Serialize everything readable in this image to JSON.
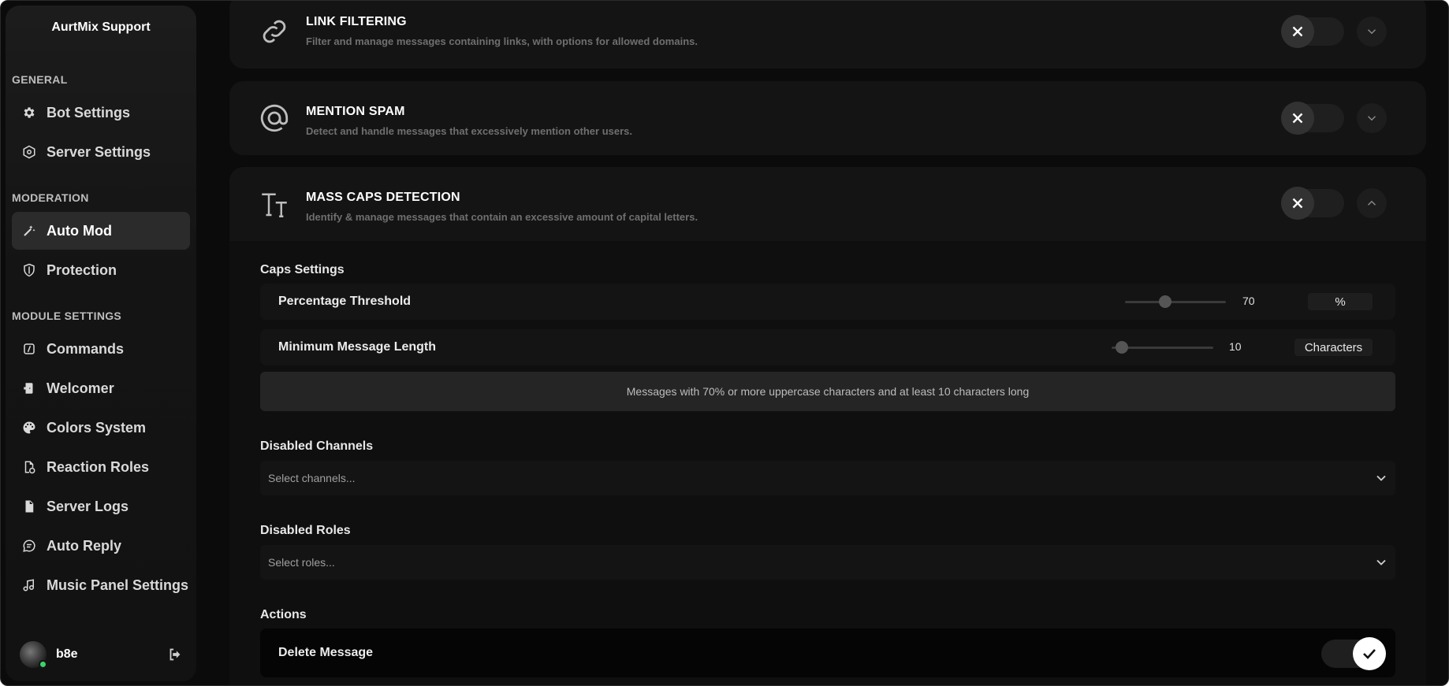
{
  "sidebar": {
    "brand": "AurtMix Support",
    "sections": [
      {
        "title": "GENERAL",
        "items": [
          {
            "label": "Bot Settings",
            "icon": "gear-icon"
          },
          {
            "label": "Server Settings",
            "icon": "hexagon-icon"
          }
        ]
      },
      {
        "title": "MODERATION",
        "items": [
          {
            "label": "Auto Mod",
            "icon": "magic-wand-icon",
            "active": true
          },
          {
            "label": "Protection",
            "icon": "shield-icon"
          }
        ]
      },
      {
        "title": "MODULE SETTINGS",
        "items": [
          {
            "label": "Commands",
            "icon": "slash-command-icon"
          },
          {
            "label": "Welcomer",
            "icon": "door-icon"
          },
          {
            "label": "Colors System",
            "icon": "palette-icon"
          },
          {
            "label": "Reaction Roles",
            "icon": "roles-icon"
          },
          {
            "label": "Server Logs",
            "icon": "file-icon"
          },
          {
            "label": "Auto Reply",
            "icon": "chat-icon"
          },
          {
            "label": "Music Panel Settings",
            "icon": "music-icon"
          }
        ]
      }
    ],
    "user": {
      "name": "b8e",
      "status": "online",
      "status_color": "#3bd26b"
    }
  },
  "modules": [
    {
      "title": "LINK FILTERING",
      "description": "Filter and manage messages containing links, with options for allowed domains.",
      "icon": "link-icon",
      "enabled": false,
      "expanded": false
    },
    {
      "title": "MENTION SPAM",
      "description": "Detect and handle messages that excessively mention other users.",
      "icon": "at-icon",
      "enabled": false,
      "expanded": false
    },
    {
      "title": "MASS CAPS DETECTION",
      "description": "Identify & manage messages that contain an excessive amount of capital letters.",
      "icon": "text-case-icon",
      "enabled": false,
      "expanded": true
    }
  ],
  "caps": {
    "section_label": "Caps Settings",
    "percentage": {
      "label": "Percentage Threshold",
      "value": "70",
      "unit": "%",
      "fraction": 0.4
    },
    "min_length": {
      "label": "Minimum Message Length",
      "value": "10",
      "unit": "Characters",
      "fraction": 0.1
    },
    "summary": "Messages with 70% or more uppercase characters and at least 10 characters long",
    "disabled_channels": {
      "label": "Disabled Channels",
      "placeholder": "Select channels..."
    },
    "disabled_roles": {
      "label": "Disabled Roles",
      "placeholder": "Select roles..."
    },
    "actions_label": "Actions",
    "actions": [
      {
        "label": "Delete Message",
        "enabled": true
      }
    ]
  }
}
